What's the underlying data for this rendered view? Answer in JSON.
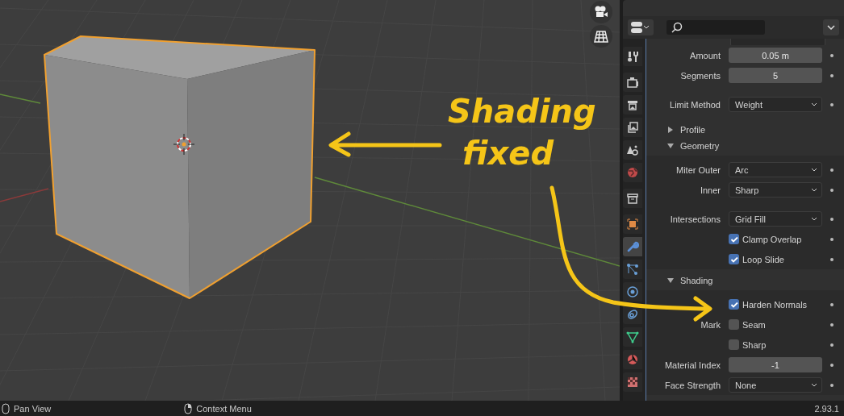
{
  "viewport": {
    "annotation": {
      "lines": [
        "Shading",
        "fixed"
      ]
    }
  },
  "properties": {
    "tab_groups": [
      [
        {
          "selected": false
        }
      ],
      [
        {
          "selected": false
        },
        {
          "selected": false
        },
        {
          "selected": false
        },
        {
          "selected": false
        },
        {
          "selected": false
        }
      ],
      [
        {
          "selected": false
        }
      ],
      [
        {
          "selected": false
        },
        {
          "selected": true
        },
        {
          "selected": false
        },
        {
          "selected": false
        },
        {
          "selected": false
        },
        {
          "selected": false
        },
        {
          "selected": false
        },
        {
          "selected": false
        }
      ]
    ],
    "items": [
      {
        "kind": "group",
        "rows": [
          {
            "kind": "number",
            "label": "Amount",
            "value": "0.05 m"
          },
          {
            "kind": "number",
            "label": "Segments",
            "value": "5"
          }
        ]
      },
      {
        "kind": "group",
        "rows": [
          {
            "kind": "dropdown",
            "label": "Limit Method",
            "value": "Weight"
          }
        ]
      },
      {
        "kind": "subpanel",
        "label": "Profile",
        "expanded": false
      },
      {
        "kind": "subpanel",
        "label": "Geometry",
        "expanded": true,
        "groups": [
          [
            {
              "kind": "dropdown",
              "label": "Miter Outer",
              "value": "Arc"
            },
            {
              "kind": "dropdown",
              "label": "Inner",
              "value": "Sharp"
            }
          ],
          [
            {
              "kind": "dropdown",
              "label": "Intersections",
              "value": "Grid Fill"
            },
            {
              "kind": "checkbox",
              "label": "Clamp Overlap",
              "checked": true
            },
            {
              "kind": "checkbox",
              "label": "Loop Slide",
              "checked": true
            }
          ]
        ]
      },
      {
        "kind": "subpanel",
        "label": "Shading",
        "expanded": true,
        "groups": [
          [
            {
              "kind": "checkbox",
              "label": "Harden Normals",
              "checked": true
            },
            {
              "kind": "checkbox",
              "side_label": "Mark",
              "label": "Seam",
              "checked": false
            },
            {
              "kind": "checkbox",
              "label": "Sharp",
              "checked": false
            },
            {
              "kind": "number",
              "label": "Material Index",
              "value": "-1"
            },
            {
              "kind": "dropdown",
              "label": "Face Strength",
              "value": "None"
            }
          ]
        ]
      }
    ]
  },
  "status_bar": {
    "hints": [
      "Pan View",
      "Context Menu"
    ],
    "version": "2.93.1"
  }
}
